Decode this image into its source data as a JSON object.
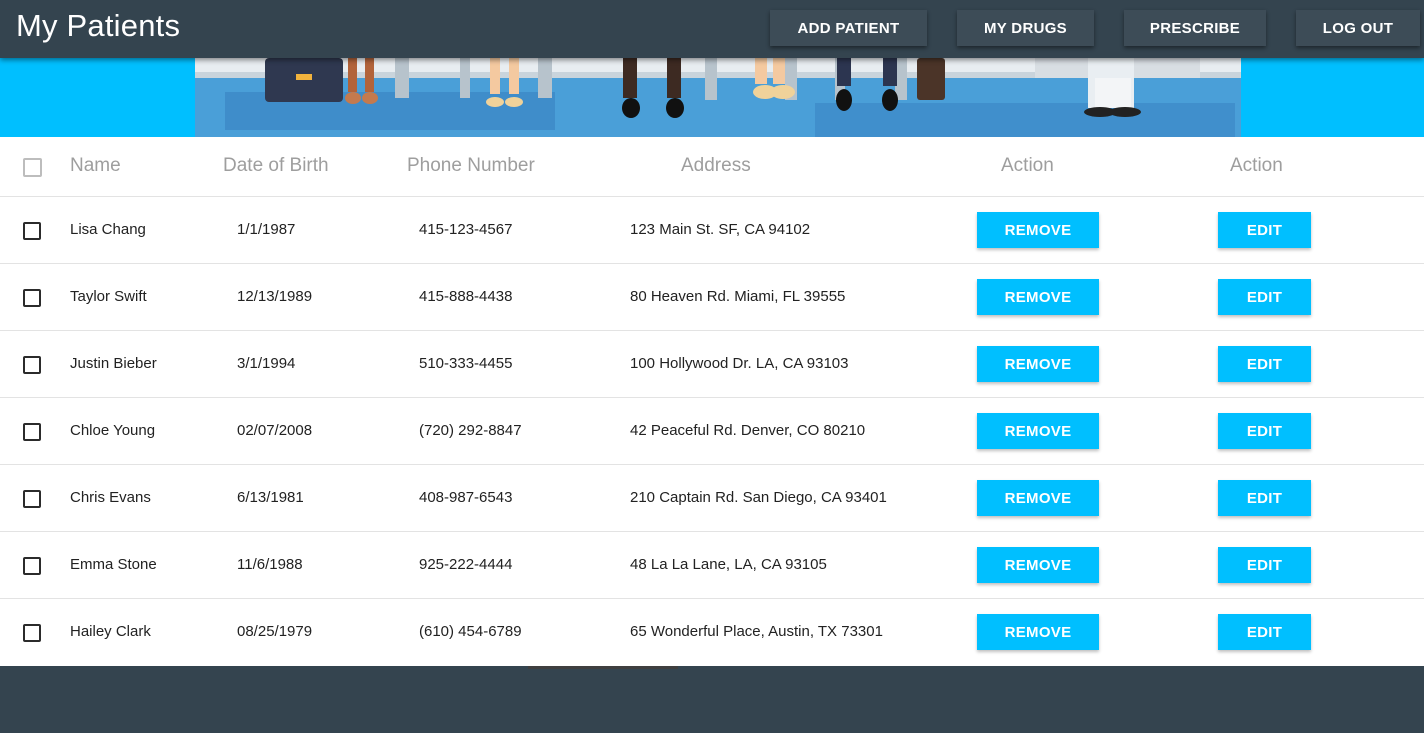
{
  "app": {
    "title": "My Patients"
  },
  "nav": {
    "add_patient": "ADD PATIENT",
    "my_drugs": "MY DRUGS",
    "prescribe": "PRESCRIBE",
    "log_out": "LOG OUT"
  },
  "table": {
    "headers": {
      "name": "Name",
      "dob": "Date of Birth",
      "phone": "Phone Number",
      "address": "Address",
      "action1": "Action",
      "action2": "Action"
    },
    "rows": [
      {
        "name": "Lisa Chang",
        "dob": "1/1/1987",
        "phone": "415-123-4567",
        "address": "123 Main St. SF, CA 94102",
        "remove": "REMOVE",
        "edit": "EDIT"
      },
      {
        "name": "Taylor Swift",
        "dob": "12/13/1989",
        "phone": "415-888-4438",
        "address": "80 Heaven Rd. Miami, FL 39555",
        "remove": "REMOVE",
        "edit": "EDIT"
      },
      {
        "name": "Justin Bieber",
        "dob": "3/1/1994",
        "phone": "510-333-4455",
        "address": "100 Hollywood Dr. LA, CA 93103",
        "remove": "REMOVE",
        "edit": "EDIT"
      },
      {
        "name": "Chloe Young",
        "dob": "02/07/2008",
        "phone": "(720) 292-8847",
        "address": "42 Peaceful Rd. Denver, CO 80210",
        "remove": "REMOVE",
        "edit": "EDIT"
      },
      {
        "name": "Chris Evans",
        "dob": "6/13/1981",
        "phone": "408-987-6543",
        "address": "210 Captain Rd. San Diego, CA 93401",
        "remove": "REMOVE",
        "edit": "EDIT"
      },
      {
        "name": "Emma Stone",
        "dob": "11/6/1988",
        "phone": "925-222-4444",
        "address": "48 La La Lane, LA, CA 93105",
        "remove": "REMOVE",
        "edit": "EDIT"
      },
      {
        "name": "Hailey Clark",
        "dob": "08/25/1979",
        "phone": "(610) 454-6789",
        "address": "65 Wonderful Place, Austin, TX 73301",
        "remove": "REMOVE",
        "edit": "EDIT"
      }
    ]
  },
  "colors": {
    "appbar": "#34444f",
    "accent": "#00bfff",
    "header_text": "#9e9e9e"
  }
}
